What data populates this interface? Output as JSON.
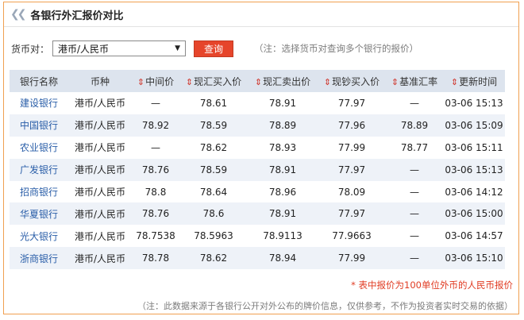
{
  "header": {
    "chevron_icon": "double-chevron-left",
    "title": "各银行外汇报价对比"
  },
  "controls": {
    "pair_label": "货币对：",
    "pair_value": "港币/人民币",
    "query_label": "查询",
    "note": "（注：选择货币对查询多个银行的报价）"
  },
  "table": {
    "sort_icon": "⇕",
    "columns": [
      "银行名称",
      "币种",
      "中间价",
      "现汇买入价",
      "现汇卖出价",
      "现钞买入价",
      "基准汇率",
      "更新时间"
    ],
    "rows": [
      [
        "建设银行",
        "港币/人民币",
        "—",
        "78.61",
        "78.91",
        "77.97",
        "—",
        "03-06 15:13"
      ],
      [
        "中国银行",
        "港币/人民币",
        "78.92",
        "78.59",
        "78.89",
        "77.96",
        "78.89",
        "03-06 15:09"
      ],
      [
        "农业银行",
        "港币/人民币",
        "—",
        "78.62",
        "78.93",
        "77.99",
        "78.77",
        "03-06 15:11"
      ],
      [
        "广发银行",
        "港币/人民币",
        "78.76",
        "78.59",
        "78.91",
        "77.97",
        "—",
        "03-06 15:13"
      ],
      [
        "招商银行",
        "港币/人民币",
        "78.8",
        "78.64",
        "78.96",
        "78.09",
        "—",
        "03-06 14:12"
      ],
      [
        "华夏银行",
        "港币/人民币",
        "78.76",
        "78.6",
        "78.91",
        "77.97",
        "—",
        "03-06 15:00"
      ],
      [
        "光大银行",
        "港币/人民币",
        "78.7538",
        "78.5963",
        "78.9113",
        "77.9663",
        "—",
        "03-06 14:57"
      ],
      [
        "浙商银行",
        "港币/人民币",
        "78.78",
        "78.62",
        "78.94",
        "77.99",
        "—",
        "03-06 15:10"
      ]
    ]
  },
  "footnote": "* 表中报价为100单位外币的人民币报价",
  "disclaimer": "（注：此数据来源于各银行公开对外公布的牌价信息，仅供参考，不作为投资者实时交易的依据）",
  "colors": {
    "accent": "#e6452b",
    "border": "#f0a050",
    "header_bg": "#dde4ee",
    "stripe": "#eef2f8",
    "link": "#2a5ea8"
  }
}
